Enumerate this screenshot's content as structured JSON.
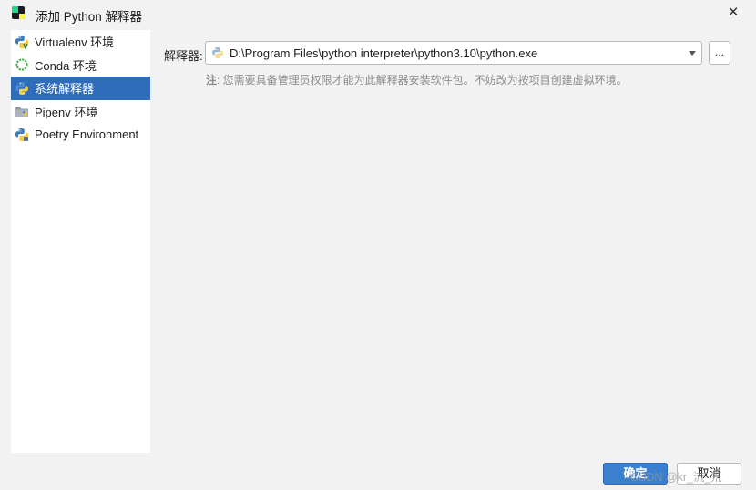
{
  "window": {
    "title": "添加 Python 解释器",
    "close_glyph": "✕"
  },
  "sidebar": {
    "items": [
      {
        "label": "Virtualenv 环境",
        "icon": "python-virtualenv-icon",
        "selected": false
      },
      {
        "label": "Conda 环境",
        "icon": "conda-icon",
        "selected": false
      },
      {
        "label": "系统解释器",
        "icon": "python-icon",
        "selected": true
      },
      {
        "label": "Pipenv 环境",
        "icon": "pipenv-icon",
        "selected": false
      },
      {
        "label": "Poetry Environment",
        "icon": "poetry-icon",
        "selected": false
      }
    ]
  },
  "main": {
    "interpreter_label": "解释器:",
    "interpreter_path": "D:\\Program Files\\python interpreter\\python3.10\\python.exe",
    "browse_label": "...",
    "note_prefix": "注",
    "note_text": ": 您需要具备管理员权限才能为此解释器安装软件包。不妨改为按项目创建虚拟环境。"
  },
  "footer": {
    "ok_label": "确定",
    "cancel_label": "取消",
    "watermark": "CSDN @kr_流_荒"
  },
  "colors": {
    "selection": "#2f6dbb",
    "primary_button": "#3b7fcf",
    "background": "#f2f2f2"
  }
}
